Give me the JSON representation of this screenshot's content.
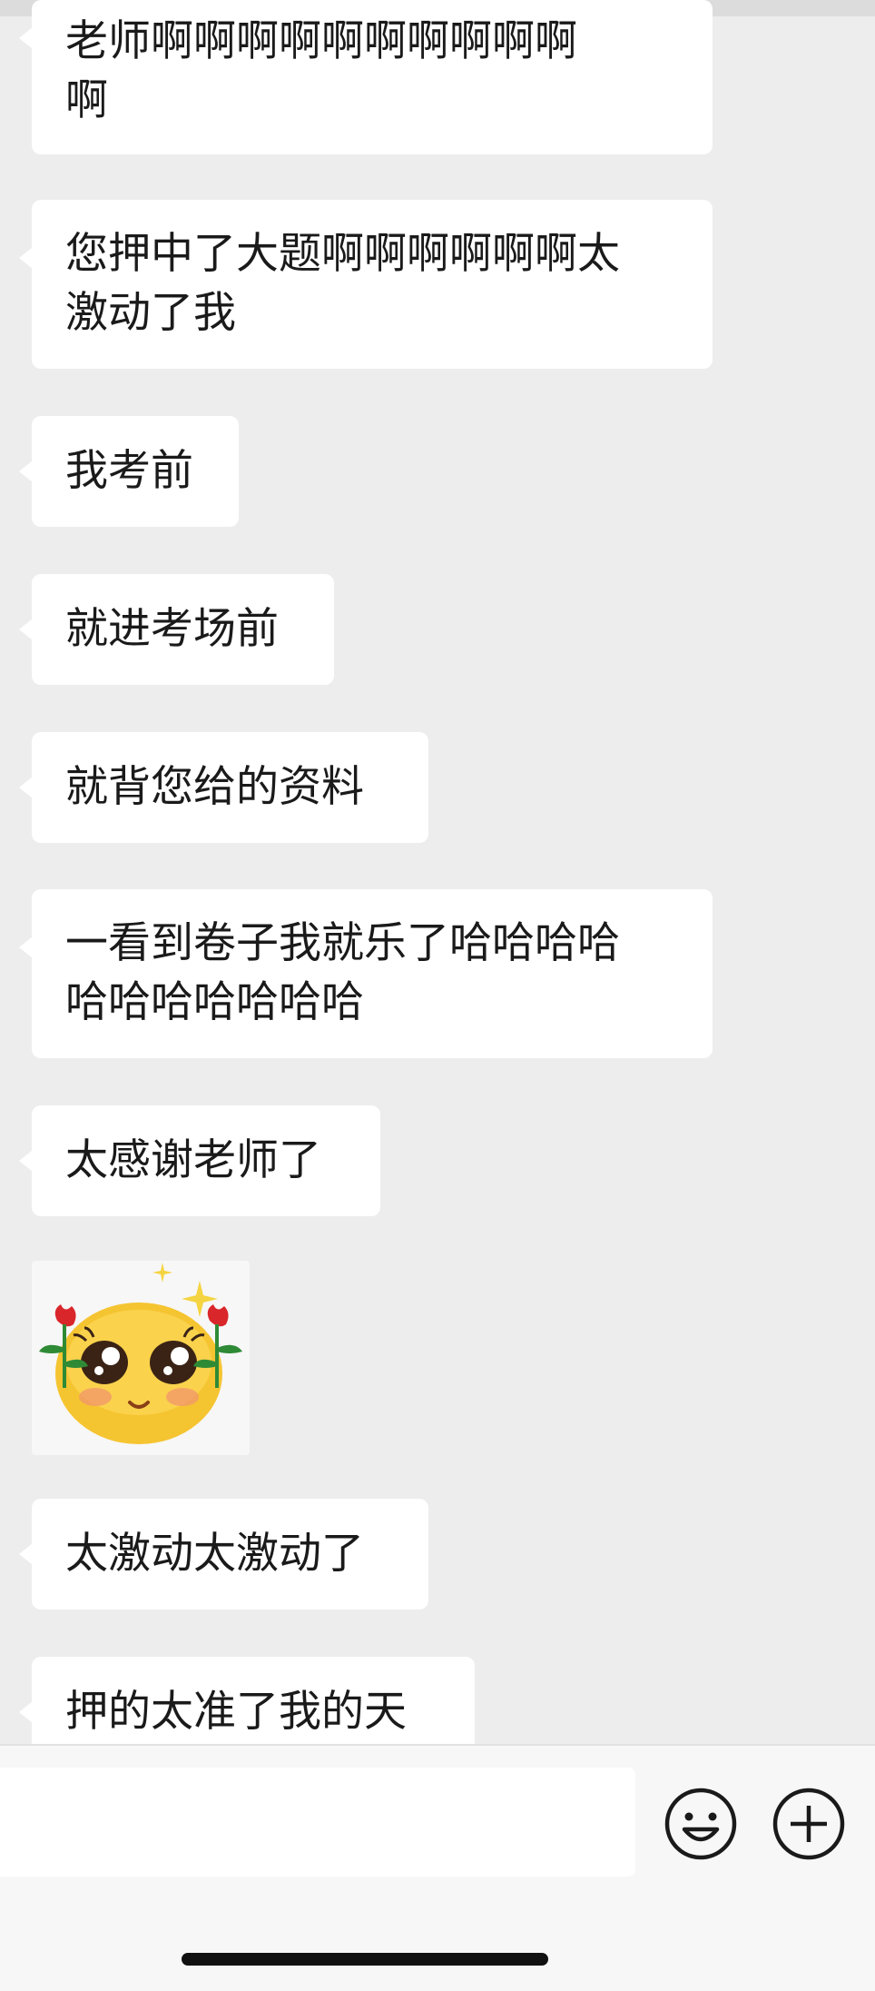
{
  "messages": [
    {
      "type": "text",
      "text": "老师啊啊啊啊啊啊啊啊啊啊\n啊"
    },
    {
      "type": "text",
      "text": "您押中了大题啊啊啊啊啊啊太\n激动了我"
    },
    {
      "type": "text",
      "text": "我考前"
    },
    {
      "type": "text",
      "text": "就进考场前"
    },
    {
      "type": "text",
      "text": "就背您给的资料"
    },
    {
      "type": "text",
      "text": "一看到卷子我就乐了哈哈哈哈\n哈哈哈哈哈哈哈"
    },
    {
      "type": "text",
      "text": "太感谢老师了"
    },
    {
      "type": "sticker",
      "icon": "cute-blushing-face-with-roses-sticker"
    },
    {
      "type": "text",
      "text": "太激动太激动了"
    },
    {
      "type": "text",
      "text": "押的太准了我的天"
    }
  ],
  "input_bar": {
    "placeholder": "",
    "emoji_icon": "emoji-icon",
    "plus_icon": "plus-icon"
  },
  "colors": {
    "background": "#ededed",
    "bubble": "#ffffff",
    "text": "#1a1a1a"
  }
}
